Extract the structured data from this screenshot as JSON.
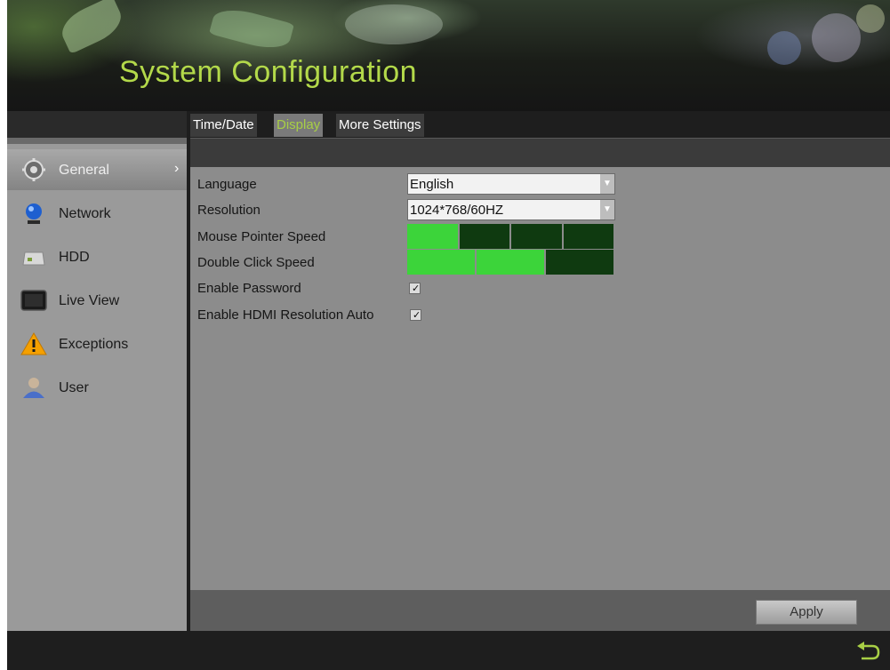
{
  "header": {
    "title": "System Configuration"
  },
  "sidebar": {
    "items": [
      {
        "label": "General",
        "icon": "gear-icon",
        "active": true
      },
      {
        "label": "Network",
        "icon": "network-globe-icon"
      },
      {
        "label": "HDD",
        "icon": "hdd-icon"
      },
      {
        "label": "Live View",
        "icon": "monitor-icon"
      },
      {
        "label": "Exceptions",
        "icon": "warning-icon"
      },
      {
        "label": "User",
        "icon": "user-icon"
      }
    ],
    "active_chevron": "›"
  },
  "tabs": [
    {
      "label": "Time/Date",
      "active": false
    },
    {
      "label": "Display",
      "active": true
    },
    {
      "label": "More Settings",
      "active": false
    }
  ],
  "settings": {
    "language": {
      "label": "Language",
      "value": "English"
    },
    "resolution": {
      "label": "Resolution",
      "value": "1024*768/60HZ"
    },
    "mouse_pointer_speed": {
      "label": "Mouse Pointer Speed",
      "level": 1,
      "max": 4
    },
    "double_click_speed": {
      "label": "Double Click Speed",
      "level": 2,
      "max": 3
    },
    "enable_password": {
      "label": "Enable Password",
      "checked": true
    },
    "enable_hdmi_resolution_auto": {
      "label": "Enable HDMI Resolution Auto",
      "checked": true
    }
  },
  "buttons": {
    "apply": "Apply"
  },
  "colors": {
    "title": "#b3d94a",
    "tab_active": "#a8cf45",
    "bar_on": "#3cd43a",
    "bar_off": "#0f3a10"
  },
  "icons": {
    "dropdown": "▼",
    "check": "✓",
    "back": "back-arrow-icon"
  }
}
